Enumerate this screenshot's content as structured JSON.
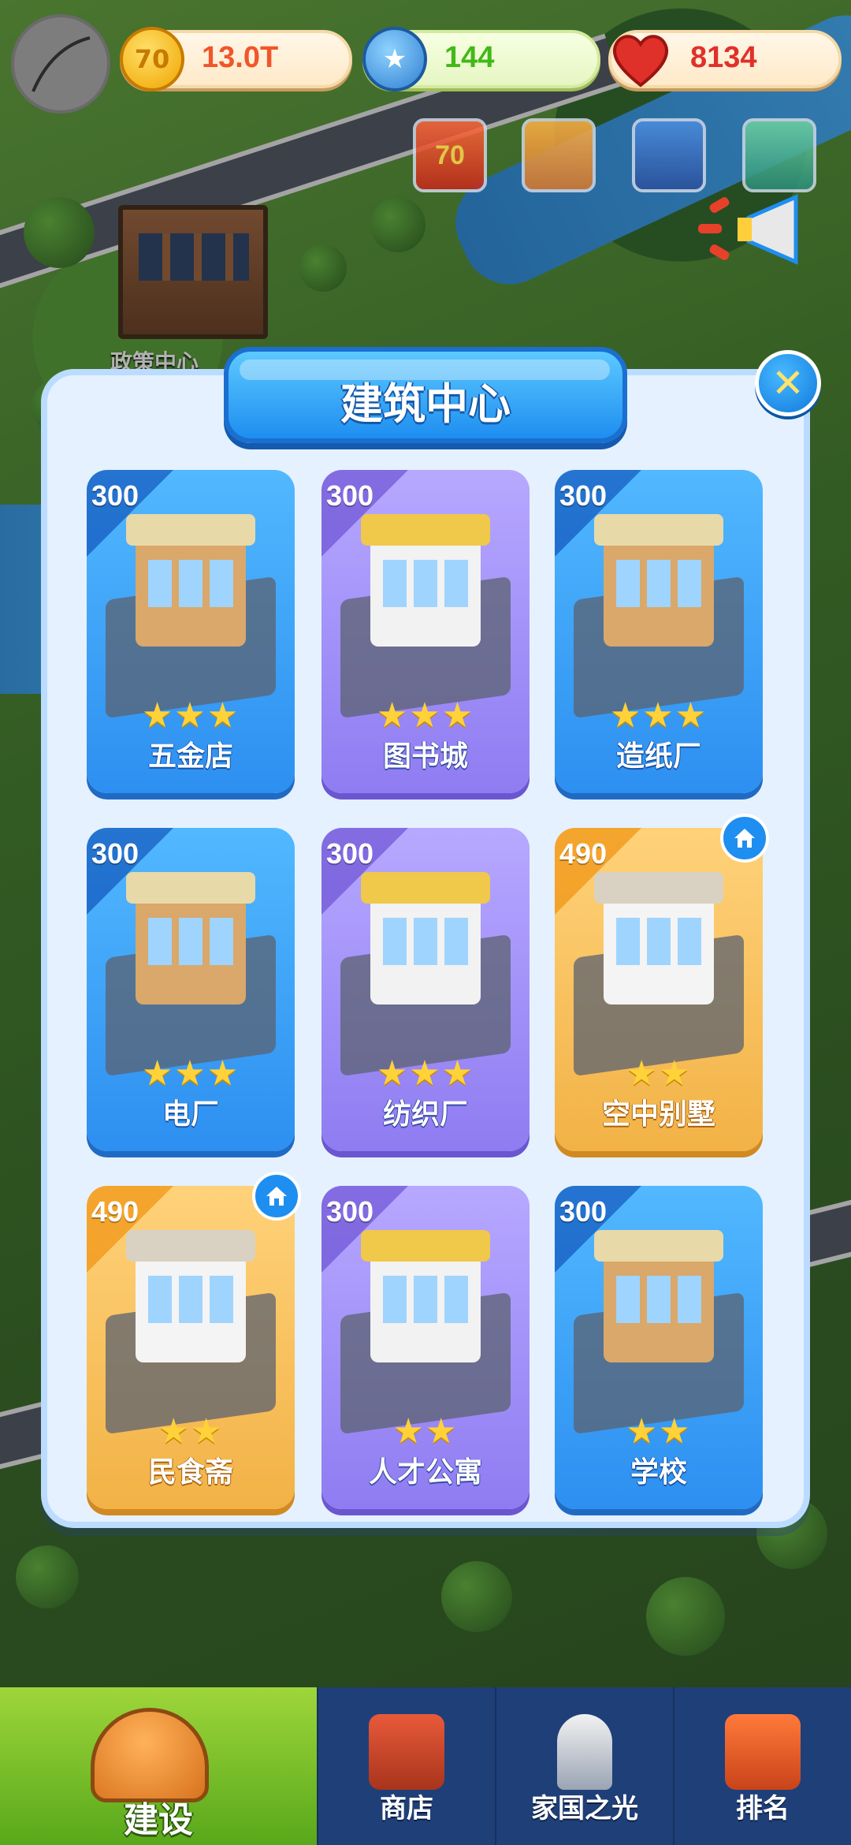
{
  "hud": {
    "coins": "13.0T",
    "stars": "144",
    "hearts": "8134",
    "coin_icon_text": "70",
    "event_icon_text": "70"
  },
  "map": {
    "building_label": "政策中心"
  },
  "modal": {
    "title": "建筑中心",
    "close_icon": "close-icon"
  },
  "buildings": [
    {
      "name": "五金店",
      "price": "300",
      "stars": "★★★",
      "star_count": 3,
      "tier": "blue"
    },
    {
      "name": "图书城",
      "price": "300",
      "stars": "★★★",
      "star_count": 3,
      "tier": "purple"
    },
    {
      "name": "造纸厂",
      "price": "300",
      "stars": "★★★",
      "star_count": 3,
      "tier": "blue"
    },
    {
      "name": "电厂",
      "price": "300",
      "stars": "★★★",
      "star_count": 3,
      "tier": "blue"
    },
    {
      "name": "纺织厂",
      "price": "300",
      "stars": "★★★",
      "star_count": 3,
      "tier": "purple"
    },
    {
      "name": "空中别墅",
      "price": "490",
      "stars": "★★",
      "star_count": 2,
      "tier": "gold",
      "home_badge": true
    },
    {
      "name": "民食斋",
      "price": "490",
      "stars": "★★",
      "star_count": 2,
      "tier": "gold",
      "home_badge": true
    },
    {
      "name": "人才公寓",
      "price": "300",
      "stars": "★★",
      "star_count": 2,
      "tier": "purple"
    },
    {
      "name": "学校",
      "price": "300",
      "stars": "★★",
      "star_count": 2,
      "tier": "blue"
    }
  ],
  "nav": [
    {
      "label": "建设",
      "icon": "hardhat-icon",
      "active": true
    },
    {
      "label": "商店",
      "icon": "shop-icon",
      "active": false
    },
    {
      "label": "家国之光",
      "icon": "rocket-icon",
      "active": false
    },
    {
      "label": "排名",
      "icon": "ranking-icon",
      "active": false
    }
  ],
  "colors": {
    "panel": "#e5f1ff",
    "title_banner": "#1e8ef0",
    "card_blue": "#2d8ff0",
    "card_purple": "#8f7cf2",
    "card_gold": "#f2b246",
    "star": "#ffd23a",
    "nav_active": "#58a81b",
    "nav_bg": "#1f3f78"
  }
}
